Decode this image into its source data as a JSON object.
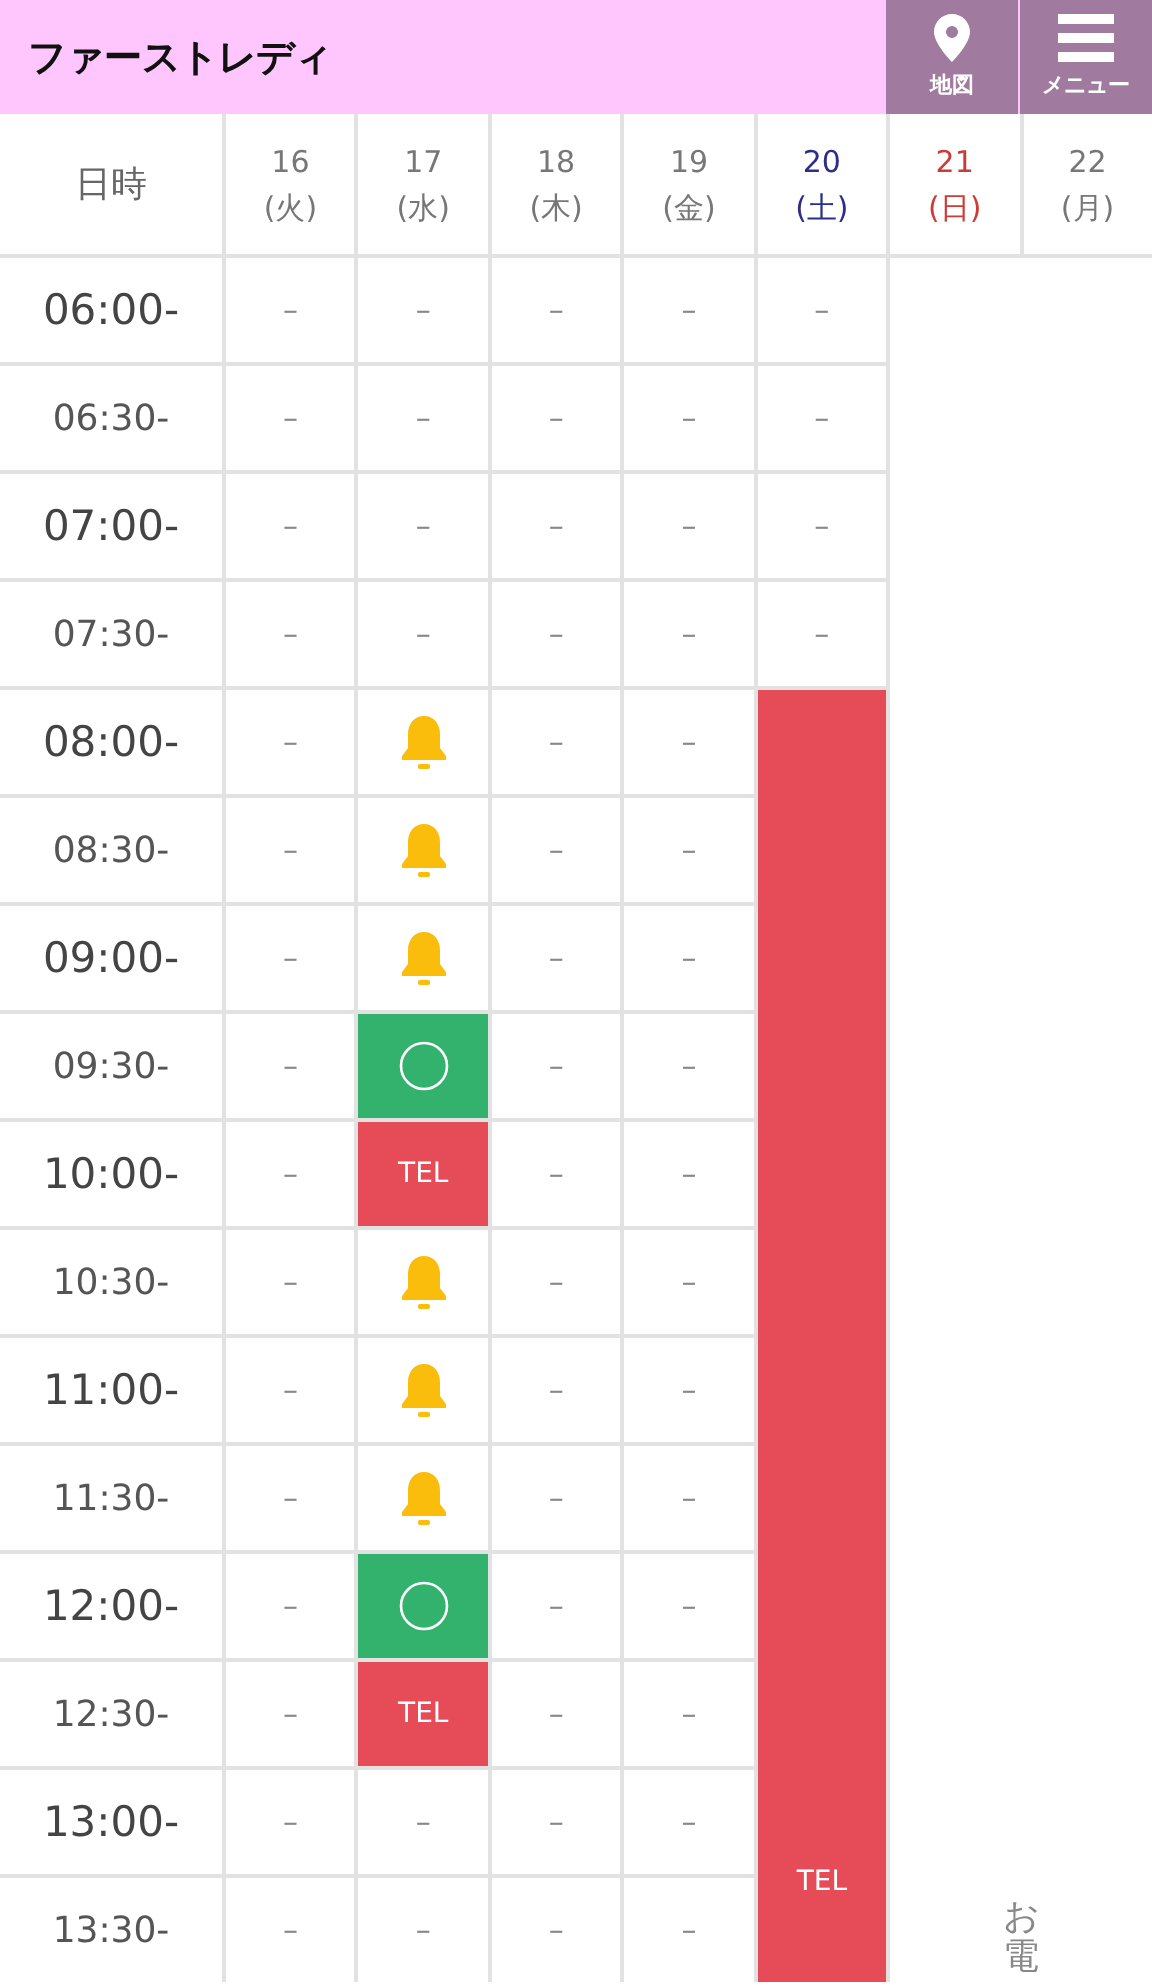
{
  "header": {
    "title": "ファーストレディ",
    "buttons": [
      {
        "kind": "map",
        "label": "地図"
      },
      {
        "kind": "menu",
        "label": "メニュー"
      }
    ]
  },
  "table": {
    "corner": "日時",
    "days": [
      {
        "date": "16",
        "weekday": "(火)",
        "color": "#777777"
      },
      {
        "date": "17",
        "weekday": "(水)",
        "color": "#777777"
      },
      {
        "date": "18",
        "weekday": "(木)",
        "color": "#777777"
      },
      {
        "date": "19",
        "weekday": "(金)",
        "color": "#777777"
      },
      {
        "date": "20",
        "weekday": "(土)",
        "color": "#2b2f86"
      },
      {
        "date": "21",
        "weekday": "(日)",
        "color": "#cc3b36"
      },
      {
        "date": "22",
        "weekday": "(月)",
        "color": "#777777"
      }
    ],
    "rows": [
      {
        "time": "06:00-",
        "major": true,
        "cells": [
          {
            "kind": "dash",
            "text": "–"
          },
          {
            "kind": "dash",
            "text": "–"
          },
          {
            "kind": "dash",
            "text": "–"
          },
          {
            "kind": "dash",
            "text": "–"
          },
          {
            "kind": "dash",
            "text": "–"
          }
        ]
      },
      {
        "time": "06:30-",
        "major": false,
        "cells": [
          {
            "kind": "dash",
            "text": "–"
          },
          {
            "kind": "dash",
            "text": "–"
          },
          {
            "kind": "dash",
            "text": "–"
          },
          {
            "kind": "dash",
            "text": "–"
          },
          {
            "kind": "dash",
            "text": "–"
          }
        ]
      },
      {
        "time": "07:00-",
        "major": true,
        "cells": [
          {
            "kind": "dash",
            "text": "–"
          },
          {
            "kind": "dash",
            "text": "–"
          },
          {
            "kind": "dash",
            "text": "–"
          },
          {
            "kind": "dash",
            "text": "–"
          },
          {
            "kind": "dash",
            "text": "–"
          }
        ]
      },
      {
        "time": "07:30-",
        "major": false,
        "cells": [
          {
            "kind": "dash",
            "text": "–"
          },
          {
            "kind": "dash",
            "text": "–"
          },
          {
            "kind": "dash",
            "text": "–"
          },
          {
            "kind": "dash",
            "text": "–"
          },
          {
            "kind": "dash",
            "text": "–"
          }
        ]
      },
      {
        "time": "08:00-",
        "major": true,
        "cells": [
          {
            "kind": "dash",
            "text": "–"
          },
          {
            "kind": "bell"
          },
          {
            "kind": "dash",
            "text": "–"
          },
          {
            "kind": "dash",
            "text": "–"
          }
        ]
      },
      {
        "time": "08:30-",
        "major": false,
        "cells": [
          {
            "kind": "dash",
            "text": "–"
          },
          {
            "kind": "bell"
          },
          {
            "kind": "dash",
            "text": "–"
          },
          {
            "kind": "dash",
            "text": "–"
          }
        ]
      },
      {
        "time": "09:00-",
        "major": true,
        "cells": [
          {
            "kind": "dash",
            "text": "–"
          },
          {
            "kind": "bell"
          },
          {
            "kind": "dash",
            "text": "–"
          },
          {
            "kind": "dash",
            "text": "–"
          }
        ]
      },
      {
        "time": "09:30-",
        "major": false,
        "cells": [
          {
            "kind": "dash",
            "text": "–"
          },
          {
            "kind": "ok"
          },
          {
            "kind": "dash",
            "text": "–"
          },
          {
            "kind": "dash",
            "text": "–"
          }
        ]
      },
      {
        "time": "10:00-",
        "major": true,
        "cells": [
          {
            "kind": "dash",
            "text": "–"
          },
          {
            "kind": "tel",
            "text": "TEL"
          },
          {
            "kind": "dash",
            "text": "–"
          },
          {
            "kind": "dash",
            "text": "–"
          }
        ]
      },
      {
        "time": "10:30-",
        "major": false,
        "cells": [
          {
            "kind": "dash",
            "text": "–"
          },
          {
            "kind": "bell"
          },
          {
            "kind": "dash",
            "text": "–"
          },
          {
            "kind": "dash",
            "text": "–"
          }
        ]
      },
      {
        "time": "11:00-",
        "major": true,
        "cells": [
          {
            "kind": "dash",
            "text": "–"
          },
          {
            "kind": "bell"
          },
          {
            "kind": "dash",
            "text": "–"
          },
          {
            "kind": "dash",
            "text": "–"
          }
        ]
      },
      {
        "time": "11:30-",
        "major": false,
        "cells": [
          {
            "kind": "dash",
            "text": "–"
          },
          {
            "kind": "bell"
          },
          {
            "kind": "dash",
            "text": "–"
          },
          {
            "kind": "dash",
            "text": "–"
          }
        ]
      },
      {
        "time": "12:00-",
        "major": true,
        "cells": [
          {
            "kind": "dash",
            "text": "–"
          },
          {
            "kind": "ok"
          },
          {
            "kind": "dash",
            "text": "–"
          },
          {
            "kind": "dash",
            "text": "–"
          }
        ]
      },
      {
        "time": "12:30-",
        "major": false,
        "cells": [
          {
            "kind": "dash",
            "text": "–"
          },
          {
            "kind": "tel",
            "text": "TEL"
          },
          {
            "kind": "dash",
            "text": "–"
          },
          {
            "kind": "dash",
            "text": "–"
          }
        ]
      },
      {
        "time": "13:00-",
        "major": true,
        "cells": [
          {
            "kind": "dash",
            "text": "–"
          },
          {
            "kind": "dash",
            "text": "–"
          },
          {
            "kind": "dash",
            "text": "–"
          },
          {
            "kind": "dash",
            "text": "–"
          }
        ]
      },
      {
        "time": "13:30-",
        "major": false,
        "cells": [
          {
            "kind": "dash",
            "text": "–"
          },
          {
            "kind": "dash",
            "text": "–"
          },
          {
            "kind": "dash",
            "text": "–"
          },
          {
            "kind": "dash",
            "text": "–"
          }
        ]
      }
    ],
    "saturday_block": {
      "kind": "tel",
      "text": "TEL"
    },
    "closed_block": {
      "text": "お電"
    }
  }
}
